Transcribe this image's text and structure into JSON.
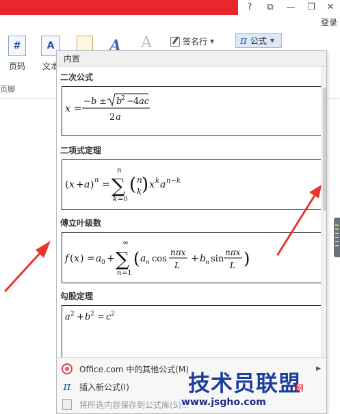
{
  "titlebar": {
    "buttons": [
      "?",
      "⧉",
      "—",
      "❐",
      "✕"
    ],
    "login": "登录"
  },
  "ribbon": {
    "page_number_label": "页码",
    "text_label": "文本",
    "footer_group_label": "页脚",
    "signature_label": "签名行",
    "formula_label": "公式"
  },
  "panel": {
    "header": "内置",
    "categories": [
      {
        "label": "二次公式"
      },
      {
        "label": "二项式定理"
      },
      {
        "label": "傅立叶级数"
      },
      {
        "label": "勾股定理"
      }
    ],
    "footer": [
      {
        "label": "Office.com 中的其他公式(M)",
        "enabled": true
      },
      {
        "label": "插入新公式(I)",
        "enabled": true
      },
      {
        "label": "将所选内容保存到公式库(S)...",
        "enabled": false
      }
    ]
  },
  "watermark": {
    "title": "技术员联盟",
    "url": "www.jsgho.com",
    "tag": "网"
  },
  "colors": {
    "title_red": "#e8262d",
    "accent_blue": "#2b579a",
    "arrow_red": "#e8352d"
  }
}
